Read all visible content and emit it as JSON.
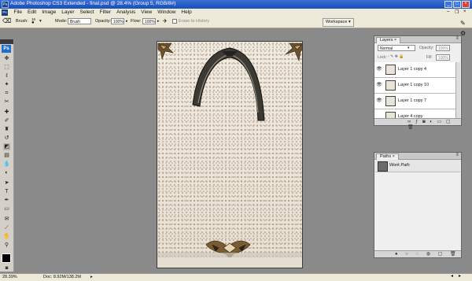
{
  "app": {
    "title": "Adobe Photoshop CS3 Extended - final.psd @ 28.4% (Group 5, RGB/8#)",
    "logo": "Ps"
  },
  "window_controls": {
    "minimize": "_",
    "maximize": "□",
    "close": "×"
  },
  "menu": {
    "items": [
      "File",
      "Edit",
      "Image",
      "Layer",
      "Select",
      "Filter",
      "Analysis",
      "View",
      "Window",
      "Help"
    ]
  },
  "options_bar": {
    "brush_label": "Brush:",
    "brush_size": "16",
    "mode_label": "Mode:",
    "mode_value": "Brush",
    "opacity_label": "Opacity:",
    "opacity_value": "100%",
    "flow_label": "Flow:",
    "flow_value": "100%",
    "erase_to_history_label": "Erase to History",
    "workspace_label": "Workspace"
  },
  "toolbox": {
    "logo": "Ps",
    "tools": [
      "move-icon",
      "marquee-icon",
      "lasso-icon",
      "magic-wand-icon",
      "crop-icon",
      "slice-icon",
      "healing-icon",
      "brush-icon",
      "stamp-icon",
      "history-brush-icon",
      "eraser-icon",
      "gradient-icon",
      "blur-icon",
      "dodge-icon",
      "path-select-icon",
      "type-icon",
      "pen-icon",
      "shape-icon",
      "notes-icon",
      "eyedropper-icon",
      "hand-icon",
      "zoom-icon"
    ]
  },
  "status": {
    "zoom": "28.39%",
    "doc_info": "Doc: 8.92M/138.2M"
  },
  "layers_panel": {
    "tab_label": "Layers",
    "blend_mode": "Normal",
    "opacity_label": "Opacity:",
    "opacity_value": "100%",
    "lock_label": "Lock:",
    "fill_label": "Fill:",
    "fill_value": "100%",
    "layers": [
      {
        "name": "Layer 1 copy 4",
        "visible": true
      },
      {
        "name": "Layer 1 copy 10",
        "visible": true
      },
      {
        "name": "Layer 1 copy 7",
        "visible": true
      },
      {
        "name": "Layer 4 copy",
        "visible": false
      }
    ]
  },
  "paths_panel": {
    "tab_label": "Paths",
    "paths": [
      {
        "name": "Work Path"
      }
    ]
  },
  "colors": {
    "workspace_bg": "#8a8a8a",
    "title_blue": "#1b4fb8",
    "paper": "#efe7dc"
  }
}
